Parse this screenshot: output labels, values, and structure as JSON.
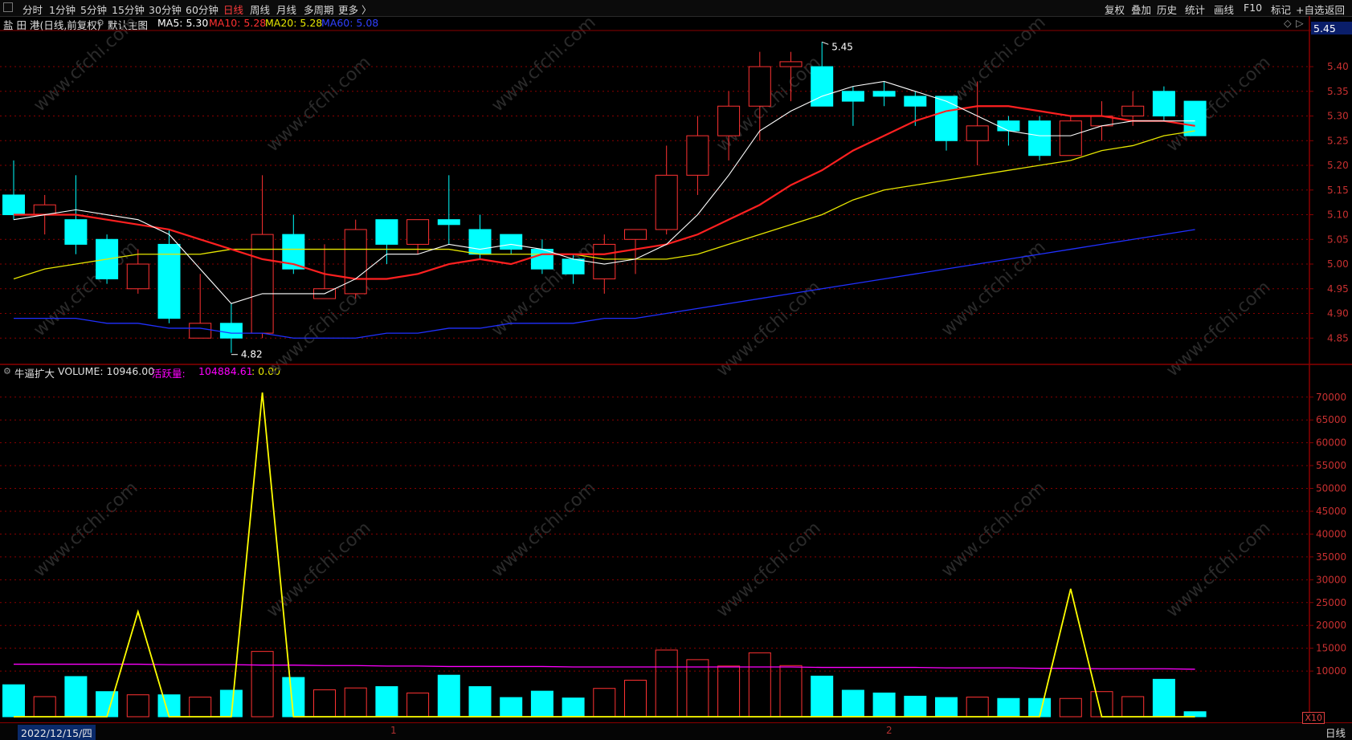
{
  "toolbar": {
    "left_items": [
      "分时",
      "1分钟",
      "5分钟",
      "15分钟",
      "30分钟",
      "60分钟",
      "日线",
      "周线",
      "月线",
      "多周期",
      "更多 〉"
    ],
    "active": "日线",
    "right_items": [
      "复权",
      "叠加",
      "历史",
      "统计",
      "画线",
      "F10",
      "标记",
      "+自选",
      "返回"
    ]
  },
  "main_header": {
    "stock": "盐 田 港(日线,前复权)",
    "chart_name": "默认主图",
    "ma5": "MA5: 5.30",
    "ma10": "MA10: 5.28",
    "ma20": "MA20: 5.28",
    "ma60": "MA60: 5.08"
  },
  "vol_header": {
    "indicator": "牛逼扩大",
    "volume": "VOLUME: 10946.00",
    "active_label": "活跃量:",
    "active_value": "104884.61",
    "extra": ": 0.00"
  },
  "price_axis": {
    "current": "5.45",
    "ticks": [
      "5.40",
      "5.35",
      "5.30",
      "5.25",
      "5.20",
      "5.15",
      "5.10",
      "5.05",
      "5.00",
      "4.95",
      "4.90",
      "4.85"
    ]
  },
  "vol_axis": {
    "ticks": [
      "70000",
      "65000",
      "60000",
      "55000",
      "50000",
      "45000",
      "40000",
      "35000",
      "30000",
      "25000",
      "20000",
      "15000",
      "10000"
    ],
    "multiplier": "X10"
  },
  "annotations": {
    "high": "5.45",
    "low": "4.82"
  },
  "bottom": {
    "date": "2022/12/15/四",
    "marks": [
      "1",
      "2"
    ],
    "period_button": "日线"
  },
  "watermark": "www.cfchi.com",
  "colors": {
    "up": "#ff3232",
    "down": "#00ffff",
    "ma5": "#ffffff",
    "ma10": "#ff2020",
    "ma20": "#e6e600",
    "ma60": "#2030ff",
    "active": "#ff00ff",
    "signal": "#ffff00",
    "grid": "#8a0000"
  },
  "chart_data": {
    "type": "candlestick",
    "candles": [
      {
        "o": 5.14,
        "c": 5.1,
        "h": 5.21,
        "l": 5.09
      },
      {
        "o": 5.1,
        "c": 5.12,
        "h": 5.14,
        "l": 5.06
      },
      {
        "o": 5.09,
        "c": 5.04,
        "h": 5.18,
        "l": 5.02
      },
      {
        "o": 5.05,
        "c": 4.97,
        "h": 5.06,
        "l": 4.96
      },
      {
        "o": 4.95,
        "c": 5.0,
        "h": 5.03,
        "l": 4.94
      },
      {
        "o": 5.04,
        "c": 4.89,
        "h": 5.07,
        "l": 4.88
      },
      {
        "o": 4.85,
        "c": 4.88,
        "h": 4.98,
        "l": 4.85
      },
      {
        "o": 4.88,
        "c": 4.85,
        "h": 4.92,
        "l": 4.82
      },
      {
        "o": 4.86,
        "c": 5.06,
        "h": 5.18,
        "l": 4.85
      },
      {
        "o": 5.06,
        "c": 4.99,
        "h": 5.1,
        "l": 4.98
      },
      {
        "o": 4.93,
        "c": 4.95,
        "h": 5.04,
        "l": 4.93
      },
      {
        "o": 4.94,
        "c": 5.07,
        "h": 5.09,
        "l": 4.93
      },
      {
        "o": 5.09,
        "c": 5.04,
        "h": 5.09,
        "l": 5.0
      },
      {
        "o": 5.04,
        "c": 5.09,
        "h": 5.09,
        "l": 5.02
      },
      {
        "o": 5.09,
        "c": 5.08,
        "h": 5.18,
        "l": 5.04
      },
      {
        "o": 5.07,
        "c": 5.02,
        "h": 5.1,
        "l": 5.01
      },
      {
        "o": 5.06,
        "c": 5.03,
        "h": 5.06,
        "l": 5.02
      },
      {
        "o": 5.03,
        "c": 4.99,
        "h": 5.05,
        "l": 4.98
      },
      {
        "o": 5.01,
        "c": 4.98,
        "h": 5.02,
        "l": 4.96
      },
      {
        "o": 4.97,
        "c": 5.04,
        "h": 5.06,
        "l": 4.94
      },
      {
        "o": 5.05,
        "c": 5.07,
        "h": 5.07,
        "l": 4.98
      },
      {
        "o": 5.07,
        "c": 5.18,
        "h": 5.24,
        "l": 5.06
      },
      {
        "o": 5.18,
        "c": 5.26,
        "h": 5.3,
        "l": 5.14
      },
      {
        "o": 5.26,
        "c": 5.32,
        "h": 5.35,
        "l": 5.21
      },
      {
        "o": 5.32,
        "c": 5.4,
        "h": 5.43,
        "l": 5.25
      },
      {
        "o": 5.4,
        "c": 5.41,
        "h": 5.43,
        "l": 5.33
      },
      {
        "o": 5.4,
        "c": 5.32,
        "h": 5.45,
        "l": 5.32
      },
      {
        "o": 5.35,
        "c": 5.33,
        "h": 5.36,
        "l": 5.28
      },
      {
        "o": 5.35,
        "c": 5.34,
        "h": 5.37,
        "l": 5.32
      },
      {
        "o": 5.34,
        "c": 5.32,
        "h": 5.35,
        "l": 5.28
      },
      {
        "o": 5.34,
        "c": 5.25,
        "h": 5.34,
        "l": 5.23
      },
      {
        "o": 5.25,
        "c": 5.28,
        "h": 5.37,
        "l": 5.2
      },
      {
        "o": 5.29,
        "c": 5.27,
        "h": 5.3,
        "l": 5.24
      },
      {
        "o": 5.29,
        "c": 5.22,
        "h": 5.3,
        "l": 5.21
      },
      {
        "o": 5.22,
        "c": 5.29,
        "h": 5.3,
        "l": 5.22
      },
      {
        "o": 5.28,
        "c": 5.3,
        "h": 5.33,
        "l": 5.25
      },
      {
        "o": 5.3,
        "c": 5.32,
        "h": 5.35,
        "l": 5.28
      },
      {
        "o": 5.35,
        "c": 5.3,
        "h": 5.36,
        "l": 5.29
      },
      {
        "o": 5.33,
        "c": 5.26,
        "h": 5.33,
        "l": 5.26
      }
    ],
    "ma5": [
      5.09,
      5.1,
      5.11,
      5.1,
      5.09,
      5.06,
      4.99,
      4.92,
      4.94,
      4.94,
      4.94,
      4.97,
      5.02,
      5.02,
      5.04,
      5.03,
      5.04,
      5.03,
      5.01,
      5.0,
      5.01,
      5.04,
      5.1,
      5.18,
      5.27,
      5.31,
      5.34,
      5.36,
      5.37,
      5.35,
      5.33,
      5.3,
      5.27,
      5.26,
      5.26,
      5.28,
      5.29,
      5.29,
      5.29
    ],
    "ma10": [
      5.1,
      5.1,
      5.1,
      5.09,
      5.08,
      5.07,
      5.05,
      5.03,
      5.01,
      5.0,
      4.98,
      4.97,
      4.97,
      4.98,
      5.0,
      5.01,
      5.0,
      5.02,
      5.02,
      5.02,
      5.03,
      5.04,
      5.06,
      5.09,
      5.12,
      5.16,
      5.19,
      5.23,
      5.26,
      5.29,
      5.31,
      5.32,
      5.32,
      5.31,
      5.3,
      5.3,
      5.29,
      5.29,
      5.28
    ],
    "ma20": [
      4.97,
      4.99,
      5.0,
      5.01,
      5.02,
      5.02,
      5.02,
      5.03,
      5.03,
      5.03,
      5.03,
      5.03,
      5.03,
      5.03,
      5.03,
      5.02,
      5.02,
      5.02,
      5.02,
      5.01,
      5.01,
      5.01,
      5.02,
      5.04,
      5.06,
      5.08,
      5.1,
      5.13,
      5.15,
      5.16,
      5.17,
      5.18,
      5.19,
      5.2,
      5.21,
      5.23,
      5.24,
      5.26,
      5.27
    ],
    "ma60": [
      4.89,
      4.89,
      4.89,
      4.88,
      4.88,
      4.87,
      4.87,
      4.86,
      4.86,
      4.85,
      4.85,
      4.85,
      4.86,
      4.86,
      4.87,
      4.87,
      4.88,
      4.88,
      4.88,
      4.89,
      4.89,
      4.9,
      4.91,
      4.92,
      4.93,
      4.94,
      4.95,
      4.96,
      4.97,
      4.98,
      4.99,
      5.0,
      5.01,
      5.02,
      5.03,
      5.04,
      5.05,
      5.06,
      5.07
    ],
    "volume": [
      7000,
      4400,
      8800,
      5500,
      4800,
      4800,
      4300,
      5800,
      14300,
      8600,
      5900,
      6300,
      6600,
      5200,
      9100,
      6600,
      4200,
      5600,
      4100,
      6200,
      8000,
      14600,
      12500,
      11100,
      14000,
      11200,
      8900,
      5800,
      5200,
      4500,
      4200,
      4300,
      4000,
      4000,
      4000,
      5500,
      4400,
      8200,
      1100
    ],
    "active_volume": [
      11500,
      11500,
      11500,
      11500,
      11500,
      11400,
      11400,
      11400,
      11300,
      11300,
      11200,
      11200,
      11100,
      11100,
      11000,
      11000,
      11000,
      11000,
      10900,
      10900,
      10900,
      10900,
      10900,
      10900,
      10900,
      10900,
      10800,
      10800,
      10800,
      10800,
      10700,
      10700,
      10700,
      10600,
      10600,
      10500,
      10500,
      10500,
      10400
    ],
    "signal": [
      0,
      0,
      0,
      0,
      23000,
      0,
      0,
      0,
      71000,
      0,
      0,
      0,
      0,
      0,
      0,
      0,
      0,
      0,
      0,
      0,
      0,
      0,
      0,
      0,
      0,
      0,
      0,
      0,
      0,
      0,
      0,
      0,
      0,
      0,
      28000,
      0,
      0,
      0,
      0
    ],
    "price_ylim": [
      4.8,
      5.47
    ],
    "volume_ylim": [
      0,
      74000
    ]
  }
}
